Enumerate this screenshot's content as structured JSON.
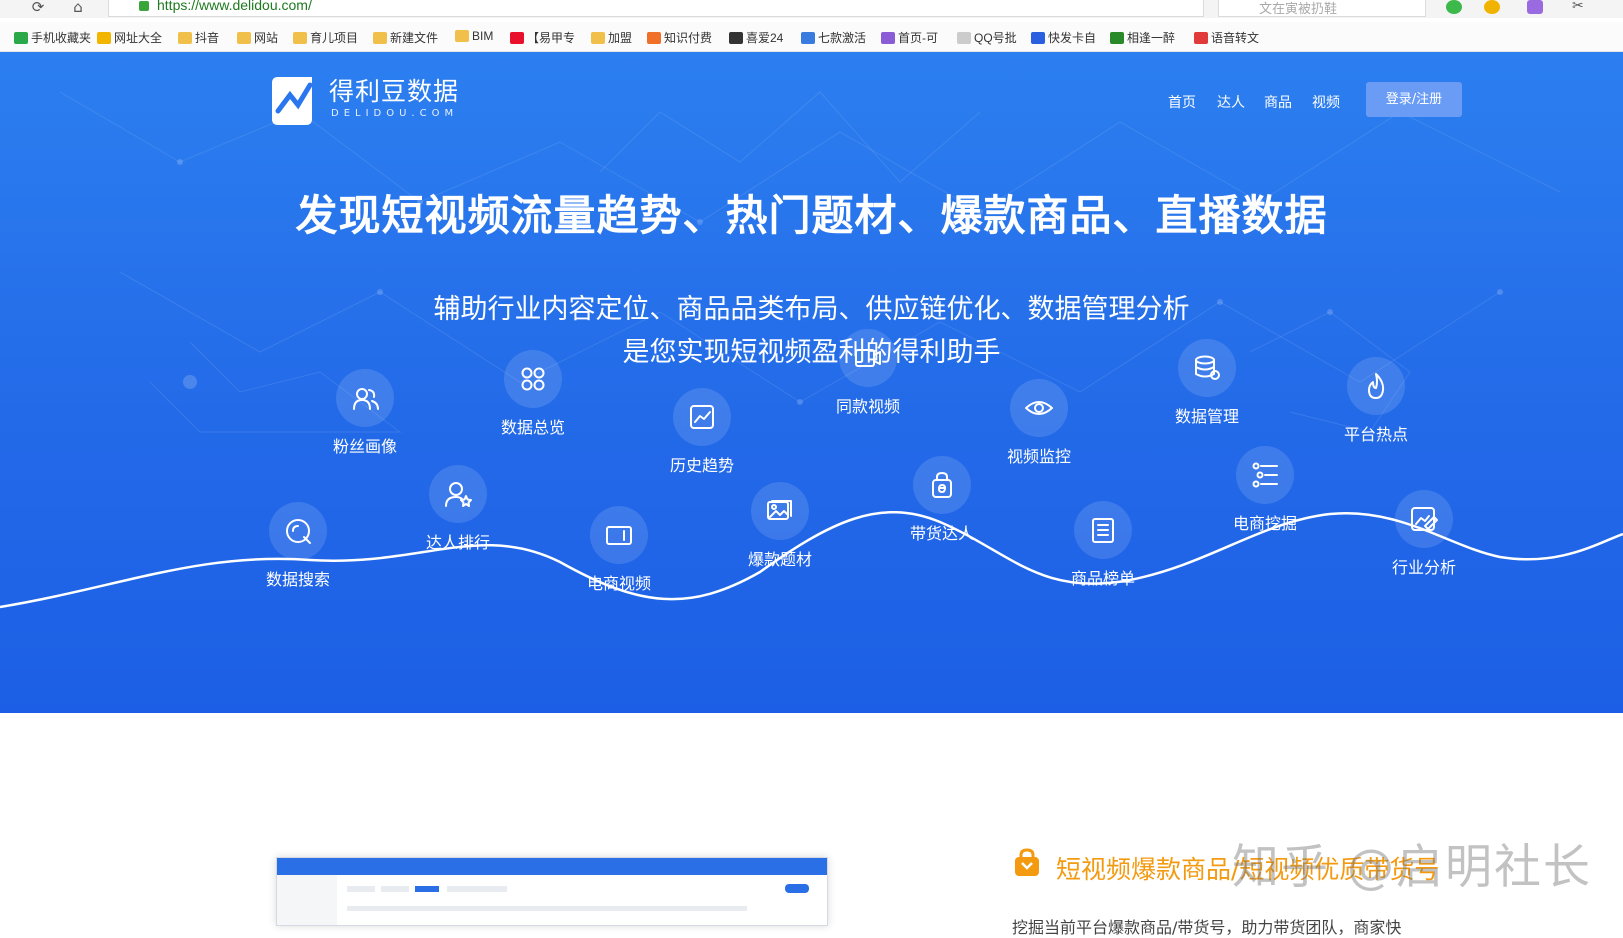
{
  "browser": {
    "url": "https://www.delidou.com/",
    "search_placeholder": "文在寅被扔鞋",
    "bookmarks": [
      {
        "label": "手机收藏夹",
        "icon": "phone-icon",
        "color": "#2aa84a"
      },
      {
        "label": "网址大全",
        "icon": "globe-icon",
        "color": "#f2b600"
      },
      {
        "label": "抖音",
        "icon": "folder-icon",
        "color": "#f1c04a"
      },
      {
        "label": "网站",
        "icon": "folder-icon",
        "color": "#f1c04a"
      },
      {
        "label": "育儿项目",
        "icon": "folder-icon",
        "color": "#f1c04a"
      },
      {
        "label": "新建文件",
        "icon": "folder-icon",
        "color": "#f1c04a"
      },
      {
        "label": "BIM",
        "icon": "folder-icon",
        "color": "#f1c04a"
      },
      {
        "label": "【易甲专",
        "icon": "t-logo-icon",
        "color": "#e8102a"
      },
      {
        "label": "加盟",
        "icon": "folder-icon",
        "color": "#f1c04a"
      },
      {
        "label": "知识付费",
        "icon": "knowledge-icon",
        "color": "#f0702a"
      },
      {
        "label": "喜爱24",
        "icon": "dollar-icon",
        "color": "#333333"
      },
      {
        "label": "七款激活",
        "icon": "c-logo-icon",
        "color": "#3a7be0"
      },
      {
        "label": "首页-可",
        "icon": "app-icon",
        "color": "#8a5cd6"
      },
      {
        "label": "QQ号批",
        "icon": "page-icon",
        "color": "#cccccc"
      },
      {
        "label": "快发卡自",
        "icon": "k-logo-icon",
        "color": "#2a5fe0"
      },
      {
        "label": "相逢一醉",
        "icon": "tree-icon",
        "color": "#2a8a2a"
      },
      {
        "label": "语音转文",
        "icon": "voice-icon",
        "color": "#e03a3a"
      }
    ]
  },
  "site": {
    "logo_cn": "得利豆数据",
    "logo_en": "DELIDOU.COM",
    "nav": [
      "首页",
      "达人",
      "商品",
      "视频"
    ],
    "login": "登录/注册"
  },
  "hero": {
    "title": "发现短视频流量趋势、热门题材、爆款商品、直播数据",
    "sub1": "辅助行业内容定位、商品品类布局、供应链优化、数据管理分析",
    "sub2": "是您实现短视频盈利的得利助手"
  },
  "features": [
    {
      "label": "粉丝画像",
      "icon": "fans-icon"
    },
    {
      "label": "数据总览",
      "icon": "grid-icon"
    },
    {
      "label": "历史趋势",
      "icon": "trend-icon"
    },
    {
      "label": "同款视频",
      "icon": "video-icon"
    },
    {
      "label": "视频监控",
      "icon": "eye-icon"
    },
    {
      "label": "数据管理",
      "icon": "database-icon"
    },
    {
      "label": "平台热点",
      "icon": "fire-icon"
    },
    {
      "label": "数据搜索",
      "icon": "search-icon"
    },
    {
      "label": "达人排行",
      "icon": "user-star-icon"
    },
    {
      "label": "电商视频",
      "icon": "camera-icon"
    },
    {
      "label": "爆款题材",
      "icon": "image-icon"
    },
    {
      "label": "带货达人",
      "icon": "bag-icon"
    },
    {
      "label": "商品榜单",
      "icon": "list-icon"
    },
    {
      "label": "电商挖掘",
      "icon": "filter-icon"
    },
    {
      "label": "行业分析",
      "icon": "edit-chart-icon"
    }
  ],
  "section": {
    "title": "短视频爆款商品/短视频优质带货号",
    "text": "挖掘当前平台爆款商品/带货号，助力带货团队，商家快"
  },
  "watermark": "知乎 @启明社长"
}
